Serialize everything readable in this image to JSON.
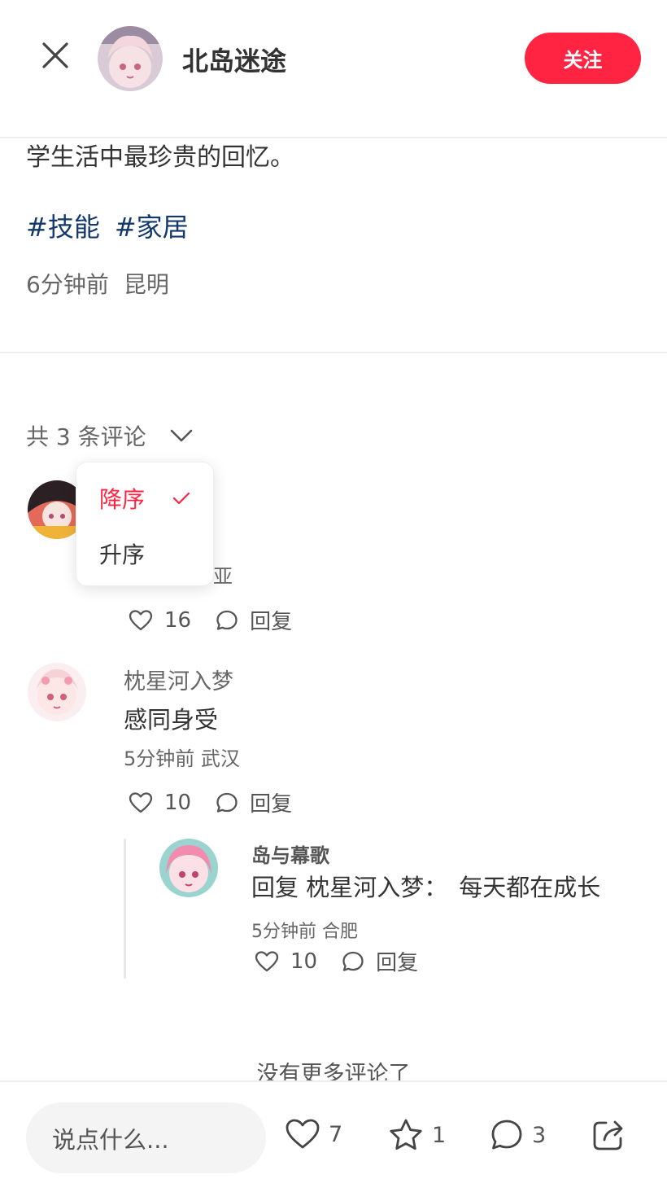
{
  "header": {
    "author_name": "北岛迷途",
    "follow_label": "关注"
  },
  "post": {
    "body_tail": "学生活中最珍贵的回忆。",
    "tags": [
      "#技能",
      "#家居"
    ],
    "time": "6分钟前",
    "location": "昆明"
  },
  "comments_header": {
    "count_label": "共 3 条评论"
  },
  "sort_menu": {
    "options": [
      "降序",
      "升序"
    ],
    "selected": "降序"
  },
  "comments": [
    {
      "meta_partial": "亚",
      "likes": "16",
      "reply_label": "回复"
    },
    {
      "author": "枕星河入梦",
      "text": "感同身受",
      "meta": "5分钟前 武汉",
      "likes": "10",
      "reply_label": "回复",
      "replies": [
        {
          "author": "岛与幕歌",
          "reply_prefix": "回复 枕星河入梦：",
          "text": "每天都在成长",
          "meta": "5分钟前 合肥",
          "likes": "10",
          "reply_label": "回复"
        }
      ]
    }
  ],
  "footer_note": "没有更多评论了",
  "bottom_bar": {
    "input_placeholder": "说点什么...",
    "like_count": "7",
    "star_count": "1",
    "comment_count": "3"
  },
  "colors": {
    "accent": "#ff2442",
    "tag": "#13386c"
  },
  "icons": [
    "close-icon",
    "chevron-down-icon",
    "check-icon",
    "heart-icon",
    "comment-icon",
    "star-icon",
    "share-icon"
  ]
}
